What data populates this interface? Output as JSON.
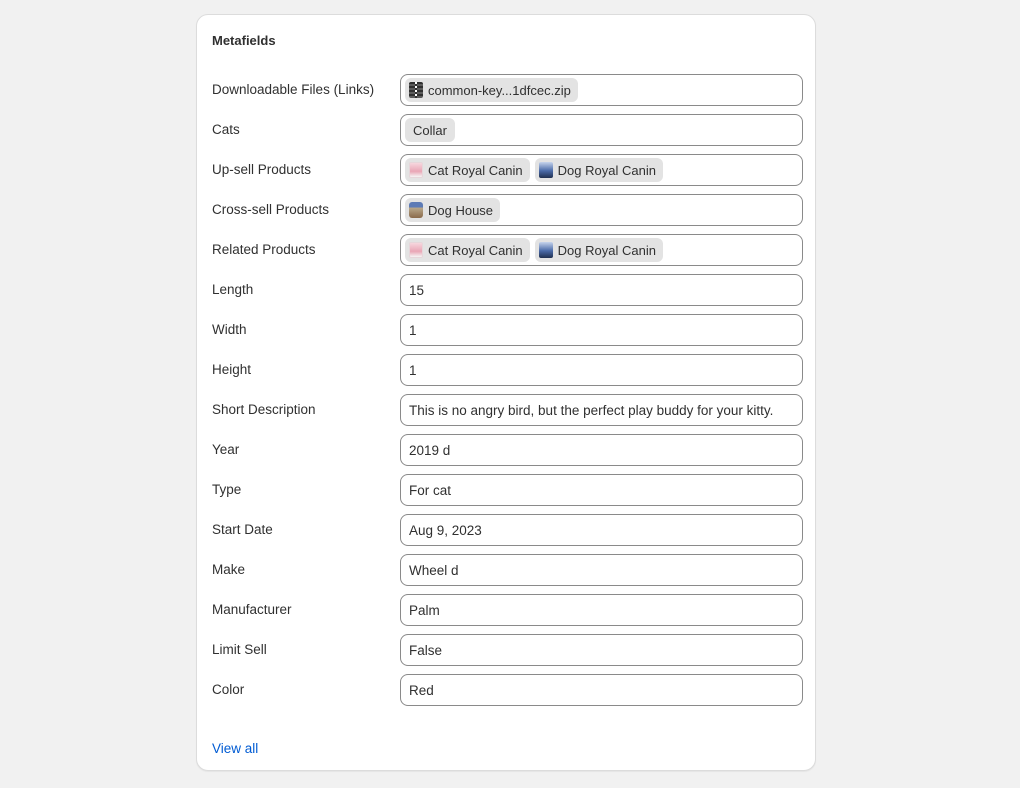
{
  "card": {
    "title": "Metafields",
    "view_all_label": "View all"
  },
  "fields": [
    {
      "label": "Downloadable Files (Links)",
      "type": "chips",
      "chips": [
        {
          "label": "common-key...1dfcec.zip",
          "icon": "zip-file-icon"
        }
      ]
    },
    {
      "label": "Cats",
      "type": "chips",
      "chips": [
        {
          "label": "Collar",
          "icon": null
        }
      ]
    },
    {
      "label": "Up-sell Products",
      "type": "chips",
      "chips": [
        {
          "label": "Cat Royal Canin",
          "icon": "cat-royal-canin-thumbnail"
        },
        {
          "label": "Dog Royal Canin",
          "icon": "dog-royal-canin-thumbnail"
        }
      ]
    },
    {
      "label": "Cross-sell Products",
      "type": "chips",
      "chips": [
        {
          "label": "Dog House",
          "icon": "dog-house-thumbnail"
        }
      ]
    },
    {
      "label": "Related Products",
      "type": "chips",
      "chips": [
        {
          "label": "Cat Royal Canin",
          "icon": "cat-royal-canin-thumbnail"
        },
        {
          "label": "Dog Royal Canin",
          "icon": "dog-royal-canin-thumbnail"
        }
      ]
    },
    {
      "label": "Length",
      "type": "text",
      "value": "15"
    },
    {
      "label": "Width",
      "type": "text",
      "value": "1"
    },
    {
      "label": "Height",
      "type": "text",
      "value": "1"
    },
    {
      "label": "Short Description",
      "type": "text",
      "value": "This is no angry bird, but the perfect play buddy for your kitty."
    },
    {
      "label": "Year",
      "type": "text",
      "value": "2019 d"
    },
    {
      "label": "Type",
      "type": "text",
      "value": "For cat"
    },
    {
      "label": "Start Date",
      "type": "text",
      "value": "Aug 9, 2023"
    },
    {
      "label": "Make",
      "type": "text",
      "value": "Wheel d"
    },
    {
      "label": "Manufacturer",
      "type": "text",
      "value": "Palm"
    },
    {
      "label": "Limit Sell",
      "type": "text",
      "value": "False"
    },
    {
      "label": "Color",
      "type": "text",
      "value": "Red"
    }
  ]
}
